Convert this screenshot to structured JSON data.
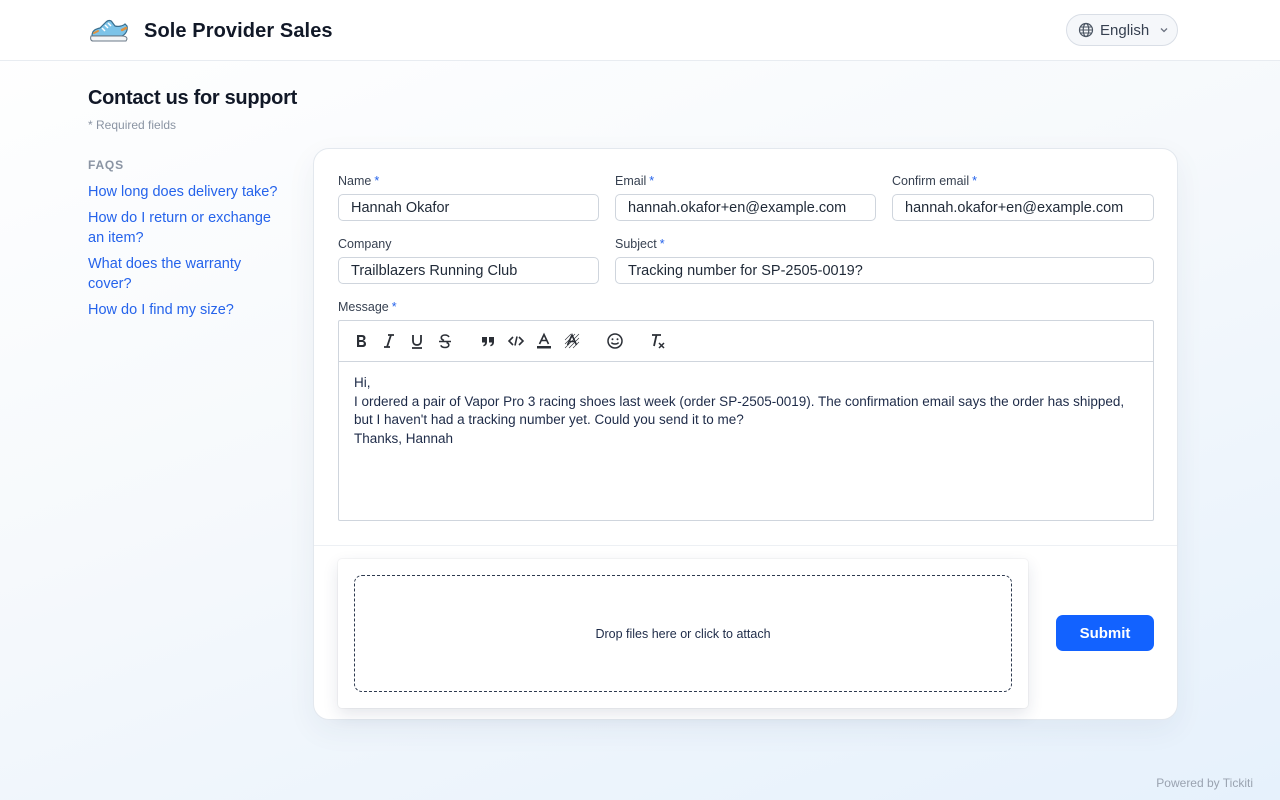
{
  "header": {
    "logo_icon": "running-shoe-icon",
    "brand": "Sole Provider Sales",
    "language": "English"
  },
  "page": {
    "title": "Contact us for support",
    "required_note": "* Required fields"
  },
  "faqs": {
    "heading": "FAQS",
    "items": [
      "How long does delivery take?",
      "How do I return or exchange an item?",
      "What does the warranty cover?",
      "How do I find my size?"
    ]
  },
  "form": {
    "required_marker": "*",
    "name": {
      "label": "Name",
      "value": "Hannah Okafor"
    },
    "email": {
      "label": "Email",
      "value": "hannah.okafor+en@example.com"
    },
    "confirm_email": {
      "label": "Confirm email",
      "value": "hannah.okafor+en@example.com"
    },
    "company": {
      "label": "Company",
      "value": "Trailblazers Running Club"
    },
    "subject": {
      "label": "Subject",
      "value": "Tracking number for SP-2505-0019?"
    },
    "message": {
      "label": "Message",
      "lines": [
        "Hi,",
        "I ordered a pair of Vapor Pro 3 racing shoes last week (order SP-2505-0019). The confirmation email says the order has shipped, but I haven't had a tracking number yet. Could you send it to me?",
        "Thanks, Hannah"
      ]
    },
    "toolbar_icons": [
      "bold-icon",
      "italic-icon",
      "underline-icon",
      "strikethrough-icon",
      "blockquote-icon",
      "code-icon",
      "text-color-icon",
      "highlight-icon",
      "emoji-icon",
      "clear-format-icon"
    ],
    "attach_text": "Drop files here or click to attach",
    "submit_label": "Submit"
  },
  "footer": {
    "powered_by": "Powered by Tickiti"
  },
  "colors": {
    "accent": "#1262ff",
    "link": "#2563eb",
    "required": "#2563eb"
  }
}
